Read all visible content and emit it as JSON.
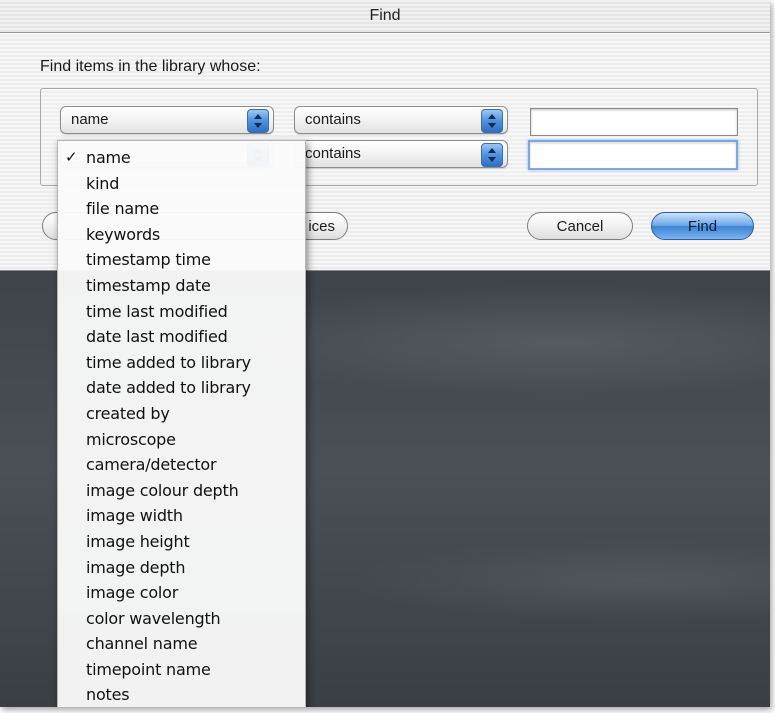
{
  "window": {
    "title": "Find"
  },
  "dialog": {
    "prompt": "Find items in the library whose:",
    "rows": [
      {
        "field": "name",
        "operator": "contains",
        "value": ""
      },
      {
        "field": "",
        "operator": "contains",
        "value": ""
      }
    ],
    "partial_button_label": "ices",
    "cancel_label": "Cancel",
    "find_label": "Find"
  },
  "field_menu": {
    "selected_index": 0,
    "check_mark": "✓",
    "items": [
      "name",
      "kind",
      "file name",
      "keywords",
      "timestamp time",
      "timestamp date",
      "time last modified",
      "date last modified",
      "time added to library",
      "date added to library",
      "created by",
      "microscope",
      "camera/detector",
      "image colour depth",
      "image width",
      "image height",
      "image depth",
      "image color",
      "color wavelength",
      "channel name",
      "timepoint name",
      "notes"
    ]
  },
  "colors": {
    "accent_blue": "#4f91dc",
    "desktop_gray": "#3d4247"
  }
}
